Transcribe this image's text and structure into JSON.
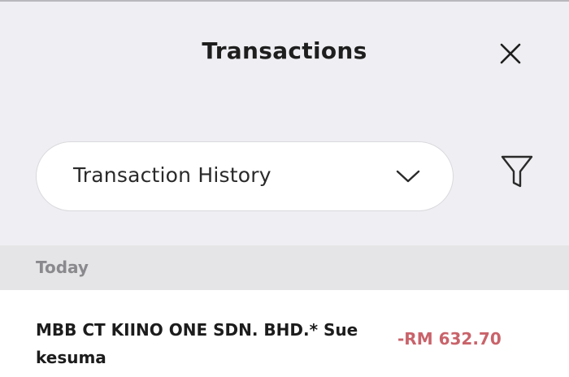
{
  "header": {
    "title": "Transactions",
    "close_icon": "close-icon"
  },
  "selector": {
    "selected_value": "Transaction History",
    "chevron_icon": "chevron-down-icon"
  },
  "filter": {
    "icon": "filter-icon"
  },
  "section": {
    "label": "Today"
  },
  "transactions": [
    {
      "description": "MBB CT KIINO ONE SDN. BHD.* Sue kesuma",
      "amount": "-RM 632.70"
    }
  ],
  "colors": {
    "background": "#efeef2",
    "section_bg": "#e5e5e7",
    "debit_amount": "#c9636a"
  }
}
